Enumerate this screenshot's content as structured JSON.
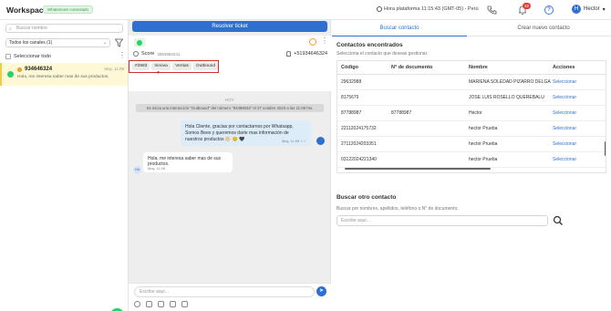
{
  "header": {
    "title": "Workspace",
    "status_badge": "Whatsmore conectado",
    "platform_time": "Hora plataforma 11:15:43 (GMT-05) - Perú",
    "notifications": "32",
    "help": "?",
    "user_name": "Hector",
    "user_initial": "H"
  },
  "left": {
    "search_placeholder": "Buscar nombre",
    "channel_filter": "Todos los canales (1)",
    "select_all": "Seleccionar todo",
    "conversation": {
      "phone": "934646324",
      "date": "May, 11:08",
      "snippet": "Hola, me interesa saber mas de sus productos."
    }
  },
  "middle": {
    "resolve_button": "Resolver ticket",
    "contact_name": "Score",
    "contact_id": "3983983241",
    "contact_phone": "+51934646324",
    "tags": [
      "#3983",
      "Innova - T",
      "Ventas",
      "Outbound"
    ],
    "day_label": "HOY",
    "system_message": "Se inicia una interacción \"Outbound\" del número \"93498034\" el 27 octubre 2023 a las 11:08 hrs.",
    "outgoing_message": "Hola Cliente, gracias por contactarnos por Whatsapp, Somos Beex y queremos darte mas información de nuestros productos 🔆 😊 🖤",
    "outgoing_time": "May, 11:08 ✓✓",
    "incoming_message": "Hola, me interesa saber mas de sus productos.",
    "incoming_time": "May, 11:08",
    "incoming_avatar": "HA",
    "message_placeholder": "Escribe aquí...",
    "send_icon": "➤"
  },
  "right": {
    "tabs": [
      "Buscar contacto",
      "Crear nuevo contacto"
    ],
    "found_title": "Contactos encontrados",
    "found_subtitle": "Selecciona el contacto que deseas gestionar.",
    "columns": [
      "Código",
      "N° de documento",
      "Nombre",
      "Acciones"
    ],
    "rows": [
      {
        "code": "29632988",
        "doc": "",
        "name": "MARIENA SOLEDAD PIZARRO DELGADO",
        "action": "Seleccionar"
      },
      {
        "code": "8175679",
        "doc": "",
        "name": "JOSE LUIS ROSELLO QUEREBALU",
        "action": "Seleccionar"
      },
      {
        "code": "87788987",
        "doc": "87788987",
        "name": "Hector",
        "action": "Seleccionar"
      },
      {
        "code": "22112024175732",
        "doc": "",
        "name": "hector Prueba",
        "action": "Seleccionar"
      },
      {
        "code": "27112024203351",
        "doc": "",
        "name": "hector Prueba",
        "action": "Seleccionar"
      },
      {
        "code": "03122024221340",
        "doc": "",
        "name": "hector Prueba",
        "action": "Seleccionar"
      }
    ],
    "search_other_title": "Buscar otro contacto",
    "search_other_subtitle": "Buscar por nombres, apellidos, teléfono o N° de documento.",
    "search_other_placeholder": "Escribe aquí..."
  },
  "colors": {
    "primary": "#2f6fd1",
    "whatsapp": "#25d366",
    "highlight": "#d32f2f",
    "selected_row": "#fff8d6"
  }
}
